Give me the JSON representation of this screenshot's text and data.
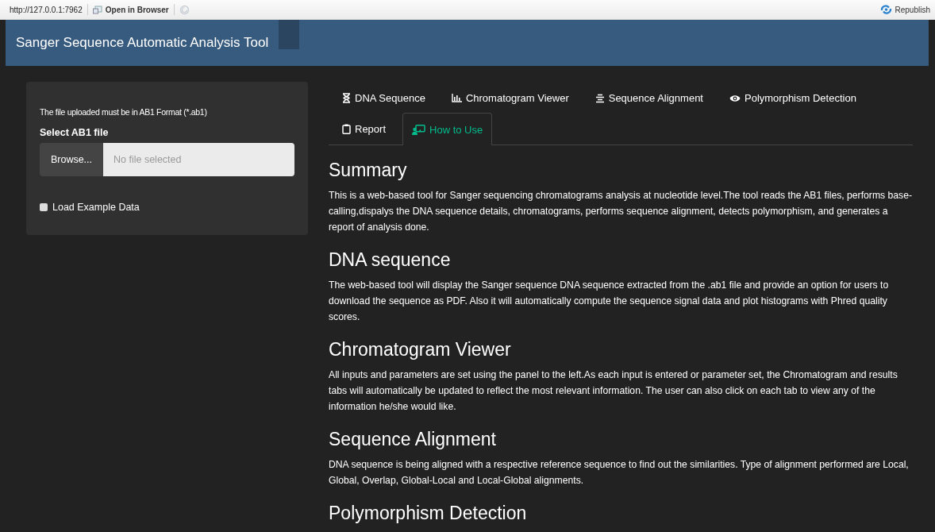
{
  "browser_bar": {
    "url": "http://127.0.0.1:7962",
    "open_button": "Open in Browser",
    "republish_button": "Republish"
  },
  "navbar": {
    "title": "Sanger Sequence Automatic Analysis Tool"
  },
  "sidebar": {
    "note": "The file uploaded must be in AB1 Format (*.ab1)",
    "file_label": "Select AB1 file",
    "browse_button": "Browse...",
    "file_placeholder": "No file selected",
    "example_checkbox": {
      "label": "Load Example Data",
      "checked": false
    }
  },
  "tabs": [
    {
      "label": "DNA Sequence",
      "selected": false
    },
    {
      "label": "Chromatogram Viewer",
      "selected": false
    },
    {
      "label": "Sequence Alignment",
      "selected": false
    },
    {
      "label": "Polymorphism Detection",
      "selected": false
    },
    {
      "label": "Report",
      "selected": false
    },
    {
      "label": "How to Use",
      "selected": true
    }
  ],
  "sections": [
    {
      "heading": "Summary",
      "text": "This is a web-based tool for Sanger sequencing chromatograms analysis at nucleotide level.The tool reads the AB1 files, performs base-calling,dispalys the DNA sequence details, chromatograms, performs sequence alignment, detects polymorphism, and generates a report of analysis done."
    },
    {
      "heading": "DNA sequence",
      "text": "The web-based tool will display the Sanger sequence DNA sequence extracted from the .ab1 file and provide an option for users to download the sequence as PDF. Also it will automatically compute the sequence signal data and plot histograms with Phred quality scores."
    },
    {
      "heading": "Chromatogram Viewer",
      "text": "All inputs and parameters are set using the panel to the left.As each input is entered or parameter set, the Chromatogram and results tabs will automatically be updated to reflect the most relevant information. The user can also click on each tab to view any of the information he/she would like."
    },
    {
      "heading": "Sequence Alignment",
      "text": "DNA sequence is being aligned with a respective reference sequence to find out the similarities. Type of alignment performed are Local, Global, Overlap, Global-Local and Local-Global alignments."
    },
    {
      "heading": "Polymorphism Detection"
    }
  ]
}
